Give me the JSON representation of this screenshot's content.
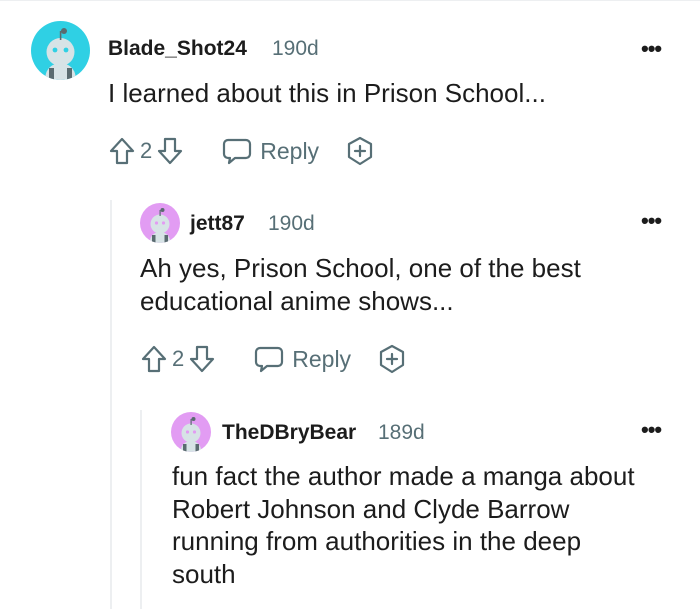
{
  "comments": [
    {
      "author": "Blade_Shot24",
      "age": "190d",
      "lines": [
        "I learned about this in Prison School..."
      ],
      "votes": "2",
      "reply_label": "Reply",
      "avatar_color": "#2fd0e4"
    },
    {
      "author": "jett87",
      "age": "190d",
      "lines": [
        "Ah yes, Prison School, one of the best",
        "educational anime shows..."
      ],
      "votes": "2",
      "reply_label": "Reply",
      "avatar_color": "#e29cf3"
    },
    {
      "author": "TheDBryBear",
      "age": "189d",
      "lines": [
        "fun fact the author made a manga about",
        "Robert Johnson and Clyde Barrow",
        "running from authorities in the deep",
        "south"
      ],
      "avatar_color": "#e29cf3"
    }
  ],
  "more_label": "•••",
  "icons": {
    "upvote": "upvote-arrow-icon",
    "downvote": "downvote-arrow-icon",
    "reply": "speech-bubble-icon",
    "award": "award-plus-icon",
    "more": "more-options-icon",
    "avatar": "snoo-avatar-icon"
  },
  "colors": {
    "meta_gray": "#576f76",
    "text": "#1c1c1c",
    "thread_line": "#edeff1"
  }
}
